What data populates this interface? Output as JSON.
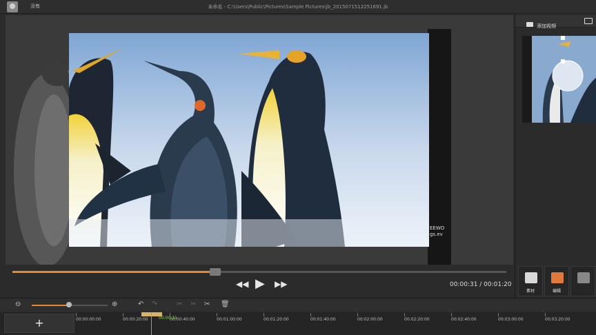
{
  "titlebar": {
    "user": "没有",
    "title": "未命名 - C:\\Users\\Public\\Pictures\\Sample Pictures\\jb_2015071512251691.jb"
  },
  "preview": {
    "watermark_line1": "EEWO",
    "watermark_line2": "gs.ev"
  },
  "transport": {
    "progress": 0.41,
    "rewind_icon": "fast-rewind-icon",
    "play_icon": "play-icon",
    "forward_icon": "fast-forward-icon",
    "timecode": "00:00:31 / 00:01:20"
  },
  "sidebar": {
    "tabs": [
      {
        "label": "添加视频",
        "icon": "video-camera-icon"
      },
      {
        "label": "",
        "icon": "folder-icon"
      }
    ],
    "tools": [
      {
        "label": "素材",
        "icon": "camera-icon",
        "color": "#d8d8d8"
      },
      {
        "label": "编辑",
        "icon": "edit-icon",
        "color": "#e07a3c"
      },
      {
        "label": "",
        "icon": "crop-icon",
        "color": "#888888"
      }
    ]
  },
  "timeline": {
    "add_label": "+",
    "clip_label": "00:00:31",
    "ticks": [
      "00:00:00:00",
      "00:00:20:00",
      "00:00:40:00",
      "00:01:00:00",
      "00:01:20:00",
      "00:01:40:00",
      "00:02:00:00",
      "00:02:20:00",
      "00:02:40:00",
      "00:03:00:00",
      "00:03:20:00"
    ]
  },
  "colors": {
    "accent": "#e8892c",
    "background": "#2b2b2b"
  }
}
